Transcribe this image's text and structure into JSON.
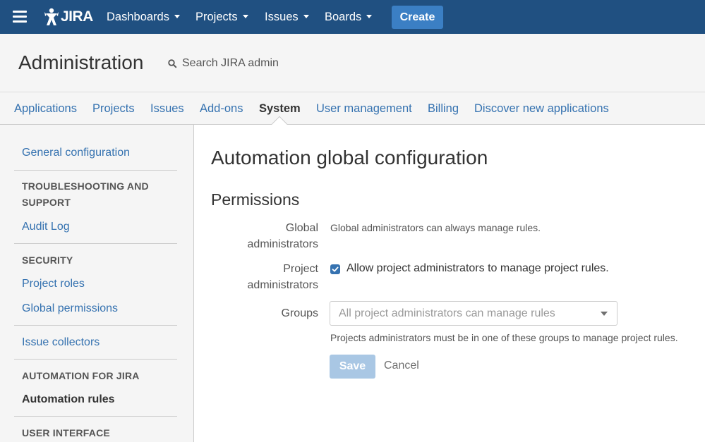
{
  "topnav": {
    "logo_text": "JIRA",
    "items": [
      {
        "label": "Dashboards"
      },
      {
        "label": "Projects"
      },
      {
        "label": "Issues"
      },
      {
        "label": "Boards"
      }
    ],
    "create_label": "Create",
    "colors": {
      "bar": "#205081",
      "create": "#3b7fc4"
    }
  },
  "header": {
    "title": "Administration",
    "search_placeholder": "Search JIRA admin"
  },
  "subtabs": [
    {
      "label": "Applications"
    },
    {
      "label": "Projects"
    },
    {
      "label": "Issues"
    },
    {
      "label": "Add-ons"
    },
    {
      "label": "System",
      "active": true
    },
    {
      "label": "User management"
    },
    {
      "label": "Billing"
    },
    {
      "label": "Discover new applications"
    }
  ],
  "sidebar": {
    "general_configuration": "General configuration",
    "troubleshooting_heading_1": "TROUBLESHOOTING AND",
    "troubleshooting_heading_2": "SUPPORT",
    "audit_log": "Audit Log",
    "security_heading": "SECURITY",
    "project_roles": "Project roles",
    "global_permissions": "Global permissions",
    "issue_collectors": "Issue collectors",
    "automation_heading": "AUTOMATION FOR JIRA",
    "automation_rules": "Automation rules",
    "user_interface_heading": "USER INTERFACE"
  },
  "main": {
    "title": "Automation global configuration",
    "section_title": "Permissions",
    "global_admins_label_1": "Global",
    "global_admins_label_2": "administrators",
    "global_admins_desc": "Global administrators can always manage rules.",
    "project_admins_label_1": "Project",
    "project_admins_label_2": "administrators",
    "project_admins_checkbox_label": "Allow project administrators to manage project rules.",
    "project_admins_checked": true,
    "groups_label": "Groups",
    "groups_select_value": "All project administrators can manage rules",
    "groups_help": "Projects administrators must be in one of these groups to manage project rules.",
    "save_label": "Save",
    "cancel_label": "Cancel"
  }
}
